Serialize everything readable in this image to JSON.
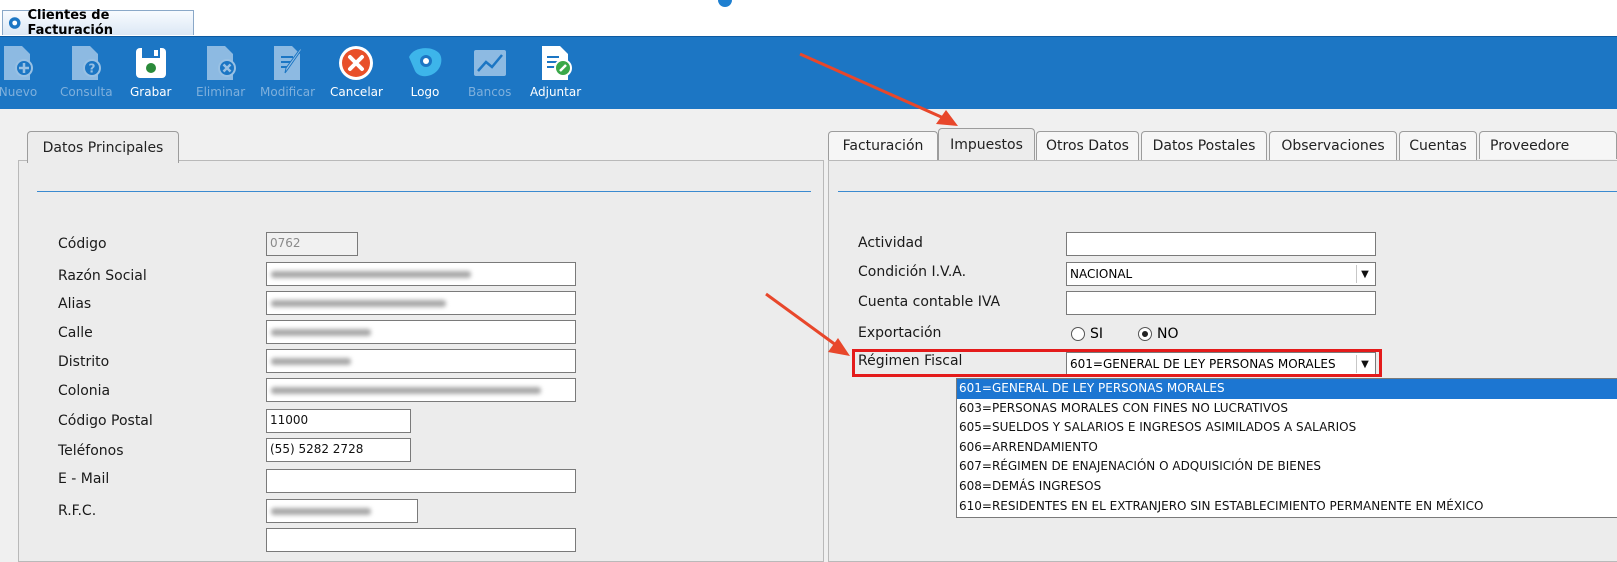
{
  "window": {
    "tab_title": "Clientes de Facturación"
  },
  "toolbar": {
    "buttons": [
      {
        "label": "Nuevo",
        "icon": "new-doc-icon",
        "enabled": false
      },
      {
        "label": "Consulta",
        "icon": "query-doc-icon",
        "enabled": false
      },
      {
        "label": "Grabar",
        "icon": "save-icon",
        "enabled": true
      },
      {
        "label": "Eliminar",
        "icon": "delete-doc-icon",
        "enabled": false
      },
      {
        "label": "Modificar",
        "icon": "edit-doc-icon",
        "enabled": false
      },
      {
        "label": "Cancelar",
        "icon": "cancel-icon",
        "enabled": true
      },
      {
        "label": "Logo",
        "icon": "logo-icon",
        "enabled": true
      },
      {
        "label": "Bancos",
        "icon": "chart-icon",
        "enabled": false
      },
      {
        "label": "Adjuntar",
        "icon": "attach-doc-icon",
        "enabled": true
      }
    ]
  },
  "left_panel": {
    "tab": "Datos Principales",
    "fields": {
      "codigo": {
        "label": "Código",
        "value": "0762"
      },
      "razon_social": {
        "label": "Razón Social"
      },
      "alias": {
        "label": "Alias"
      },
      "calle": {
        "label": "Calle"
      },
      "distrito": {
        "label": "Distrito"
      },
      "colonia": {
        "label": "Colonia"
      },
      "codigo_postal": {
        "label": "Código Postal",
        "value": "11000"
      },
      "telefonos": {
        "label": "Teléfonos",
        "value": "(55) 5282 2728"
      },
      "email": {
        "label": "E - Mail",
        "value": ""
      },
      "rfc": {
        "label": "R.F.C."
      }
    }
  },
  "right_panel": {
    "tabs": [
      "Facturación",
      "Impuestos",
      "Otros Datos",
      "Datos Postales",
      "Observaciones",
      "Cuentas",
      "Proveedore"
    ],
    "active_tab": "Impuestos",
    "fields": {
      "actividad": {
        "label": "Actividad",
        "value": ""
      },
      "condicion_iva": {
        "label": "Condición I.V.A.",
        "value": "NACIONAL"
      },
      "cuenta_iva": {
        "label": "Cuenta contable IVA",
        "value": ""
      },
      "exportacion": {
        "label": "Exportación",
        "options": [
          "SI",
          "NO"
        ],
        "selected": "NO"
      },
      "regimen_fiscal": {
        "label": "Régimen Fiscal",
        "value": "601=GENERAL DE LEY PERSONAS MORALES"
      }
    },
    "regimen_options": [
      "601=GENERAL DE LEY PERSONAS MORALES",
      "603=PERSONAS MORALES CON FINES NO LUCRATIVOS",
      "605=SUELDOS Y SALARIOS E INGRESOS ASIMILADOS A SALARIOS",
      "606=ARRENDAMIENTO",
      "607=RÉGIMEN DE ENAJENACIÓN O ADQUISICIÓN DE BIENES",
      "608=DEMÁS INGRESOS",
      "610=RESIDENTES EN EL EXTRANJERO SIN ESTABLECIMIENTO PERMANENTE EN MÉXICO"
    ]
  },
  "colors": {
    "toolbar": "#1c76c4",
    "highlight": "#e41b1b",
    "annotation_arrow": "#e8472b",
    "selection": "#1c76d2"
  }
}
